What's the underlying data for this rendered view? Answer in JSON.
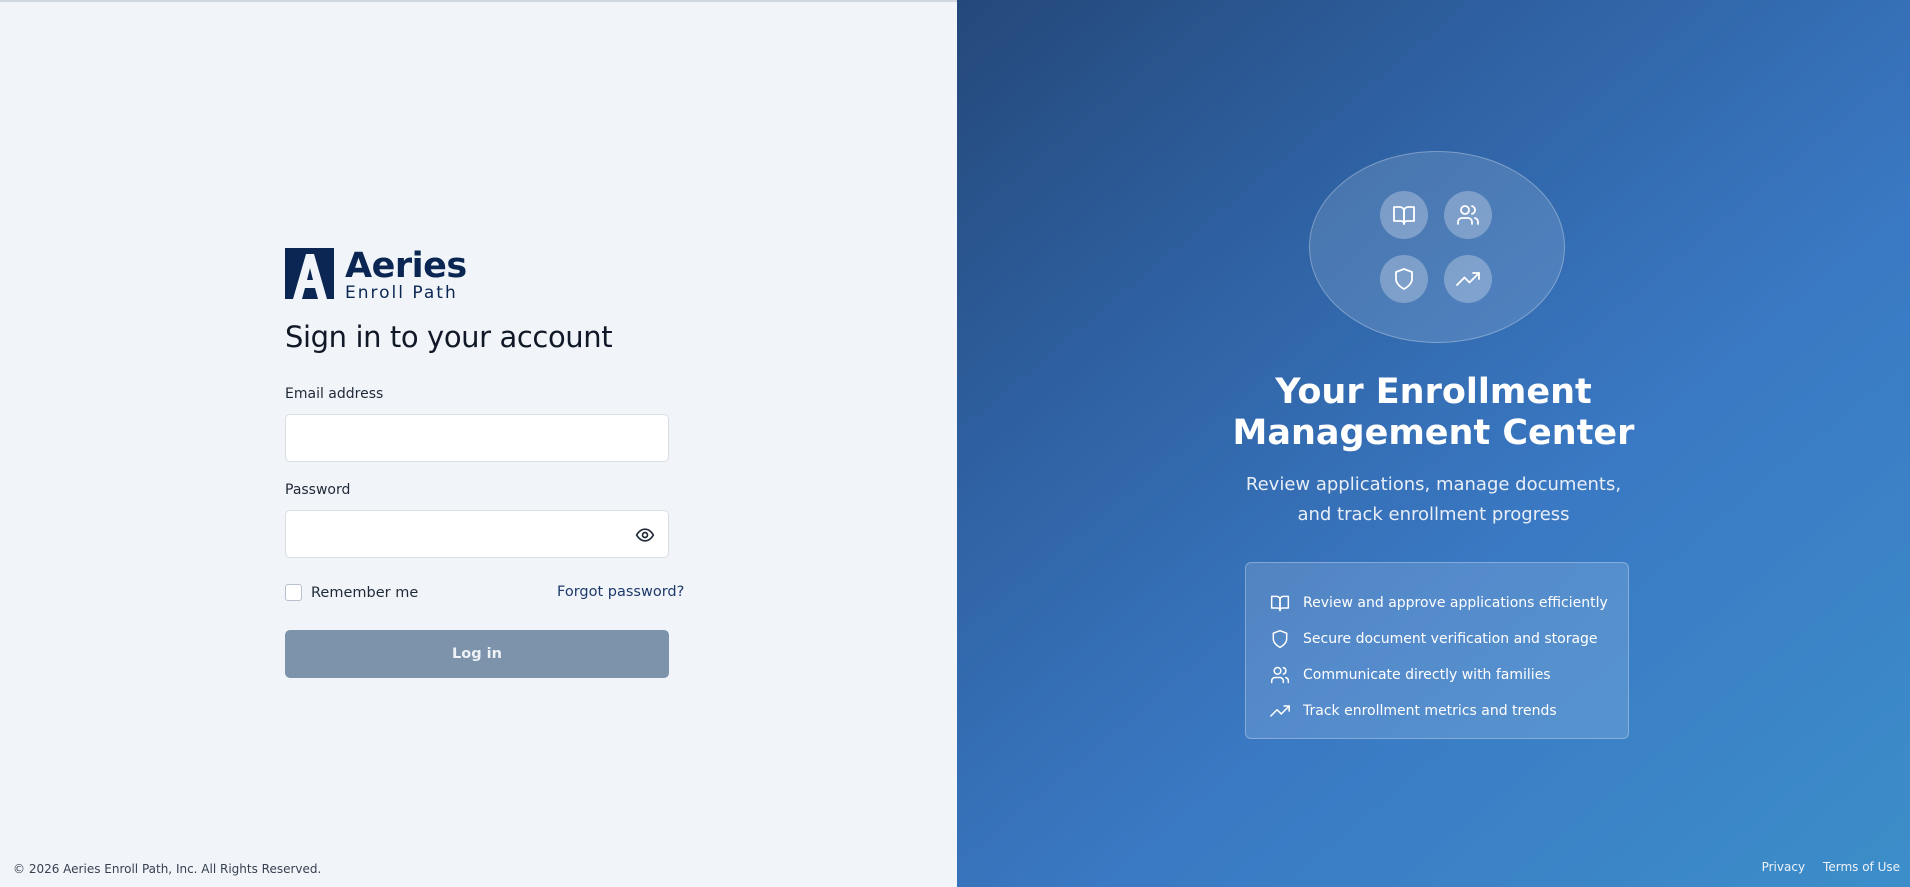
{
  "brand": {
    "name": "Aeries",
    "subtitle": "Enroll Path"
  },
  "login": {
    "title": "Sign in to your account",
    "email_label": "Email address",
    "email_value": "",
    "password_label": "Password",
    "password_value": "",
    "remember_label": "Remember me",
    "forgot_label": "Forgot password?",
    "submit_label": "Log in"
  },
  "footer": {
    "copyright": "© 2026 Aeries Enroll Path, Inc. All Rights Reserved.",
    "privacy": "Privacy",
    "terms": "Terms of Use"
  },
  "hero": {
    "title_line1": "Your Enrollment",
    "title_line2": "Management Center",
    "subtitle": "Review applications, manage documents, and track enrollment progress",
    "icons": [
      "book-open-icon",
      "users-icon",
      "shield-icon",
      "trending-up-icon"
    ],
    "features": [
      {
        "icon": "book-open-icon",
        "text": "Review and approve applications efficiently"
      },
      {
        "icon": "shield-icon",
        "text": "Secure document verification and storage"
      },
      {
        "icon": "users-icon",
        "text": "Communicate directly with families"
      },
      {
        "icon": "trending-up-icon",
        "text": "Track enrollment metrics and trends"
      }
    ]
  },
  "colors": {
    "brand_navy": "#0b2653",
    "button_disabled": "#7d93ab",
    "panel_gradient_start": "#24487a",
    "panel_gradient_end": "#3c8ec9"
  }
}
